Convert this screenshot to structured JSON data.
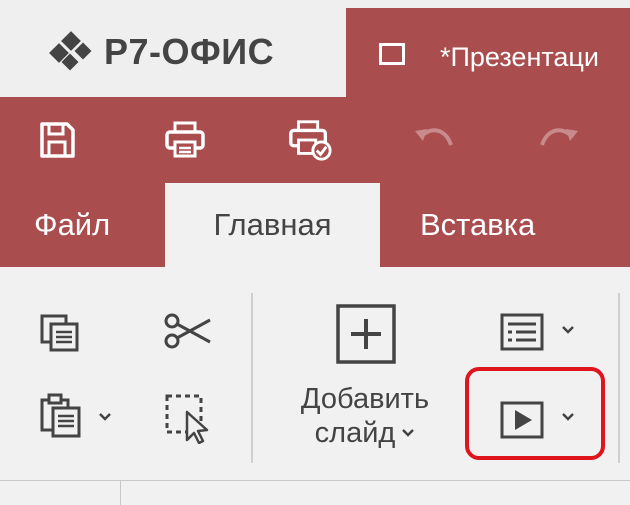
{
  "app": {
    "logo_text": "Р7-ОФИС",
    "logo_icon": "r7-logo-icon"
  },
  "document_tab": {
    "title": "*Презентаци",
    "icon": "presentation-doc-icon"
  },
  "quick_access": [
    {
      "name": "save",
      "icon": "save-icon"
    },
    {
      "name": "print",
      "icon": "print-icon"
    },
    {
      "name": "quick-print",
      "icon": "quick-print-icon"
    },
    {
      "name": "undo",
      "icon": "undo-icon"
    },
    {
      "name": "redo",
      "icon": "redo-icon"
    }
  ],
  "menu": {
    "file": "Файл",
    "home": "Главная",
    "insert": "Вставка",
    "active": "Главная"
  },
  "ribbon": {
    "add_slide_line1": "Добавить",
    "add_slide_line2": "слайд",
    "tools": [
      "copy-icon",
      "cut-icon",
      "paste-icon",
      "select-icon",
      "add-slide-icon",
      "layout-icon",
      "slideshow-icon"
    ]
  },
  "colors": {
    "accent": "#a94d4e",
    "highlight": "#e0141c",
    "text": "#444444"
  }
}
